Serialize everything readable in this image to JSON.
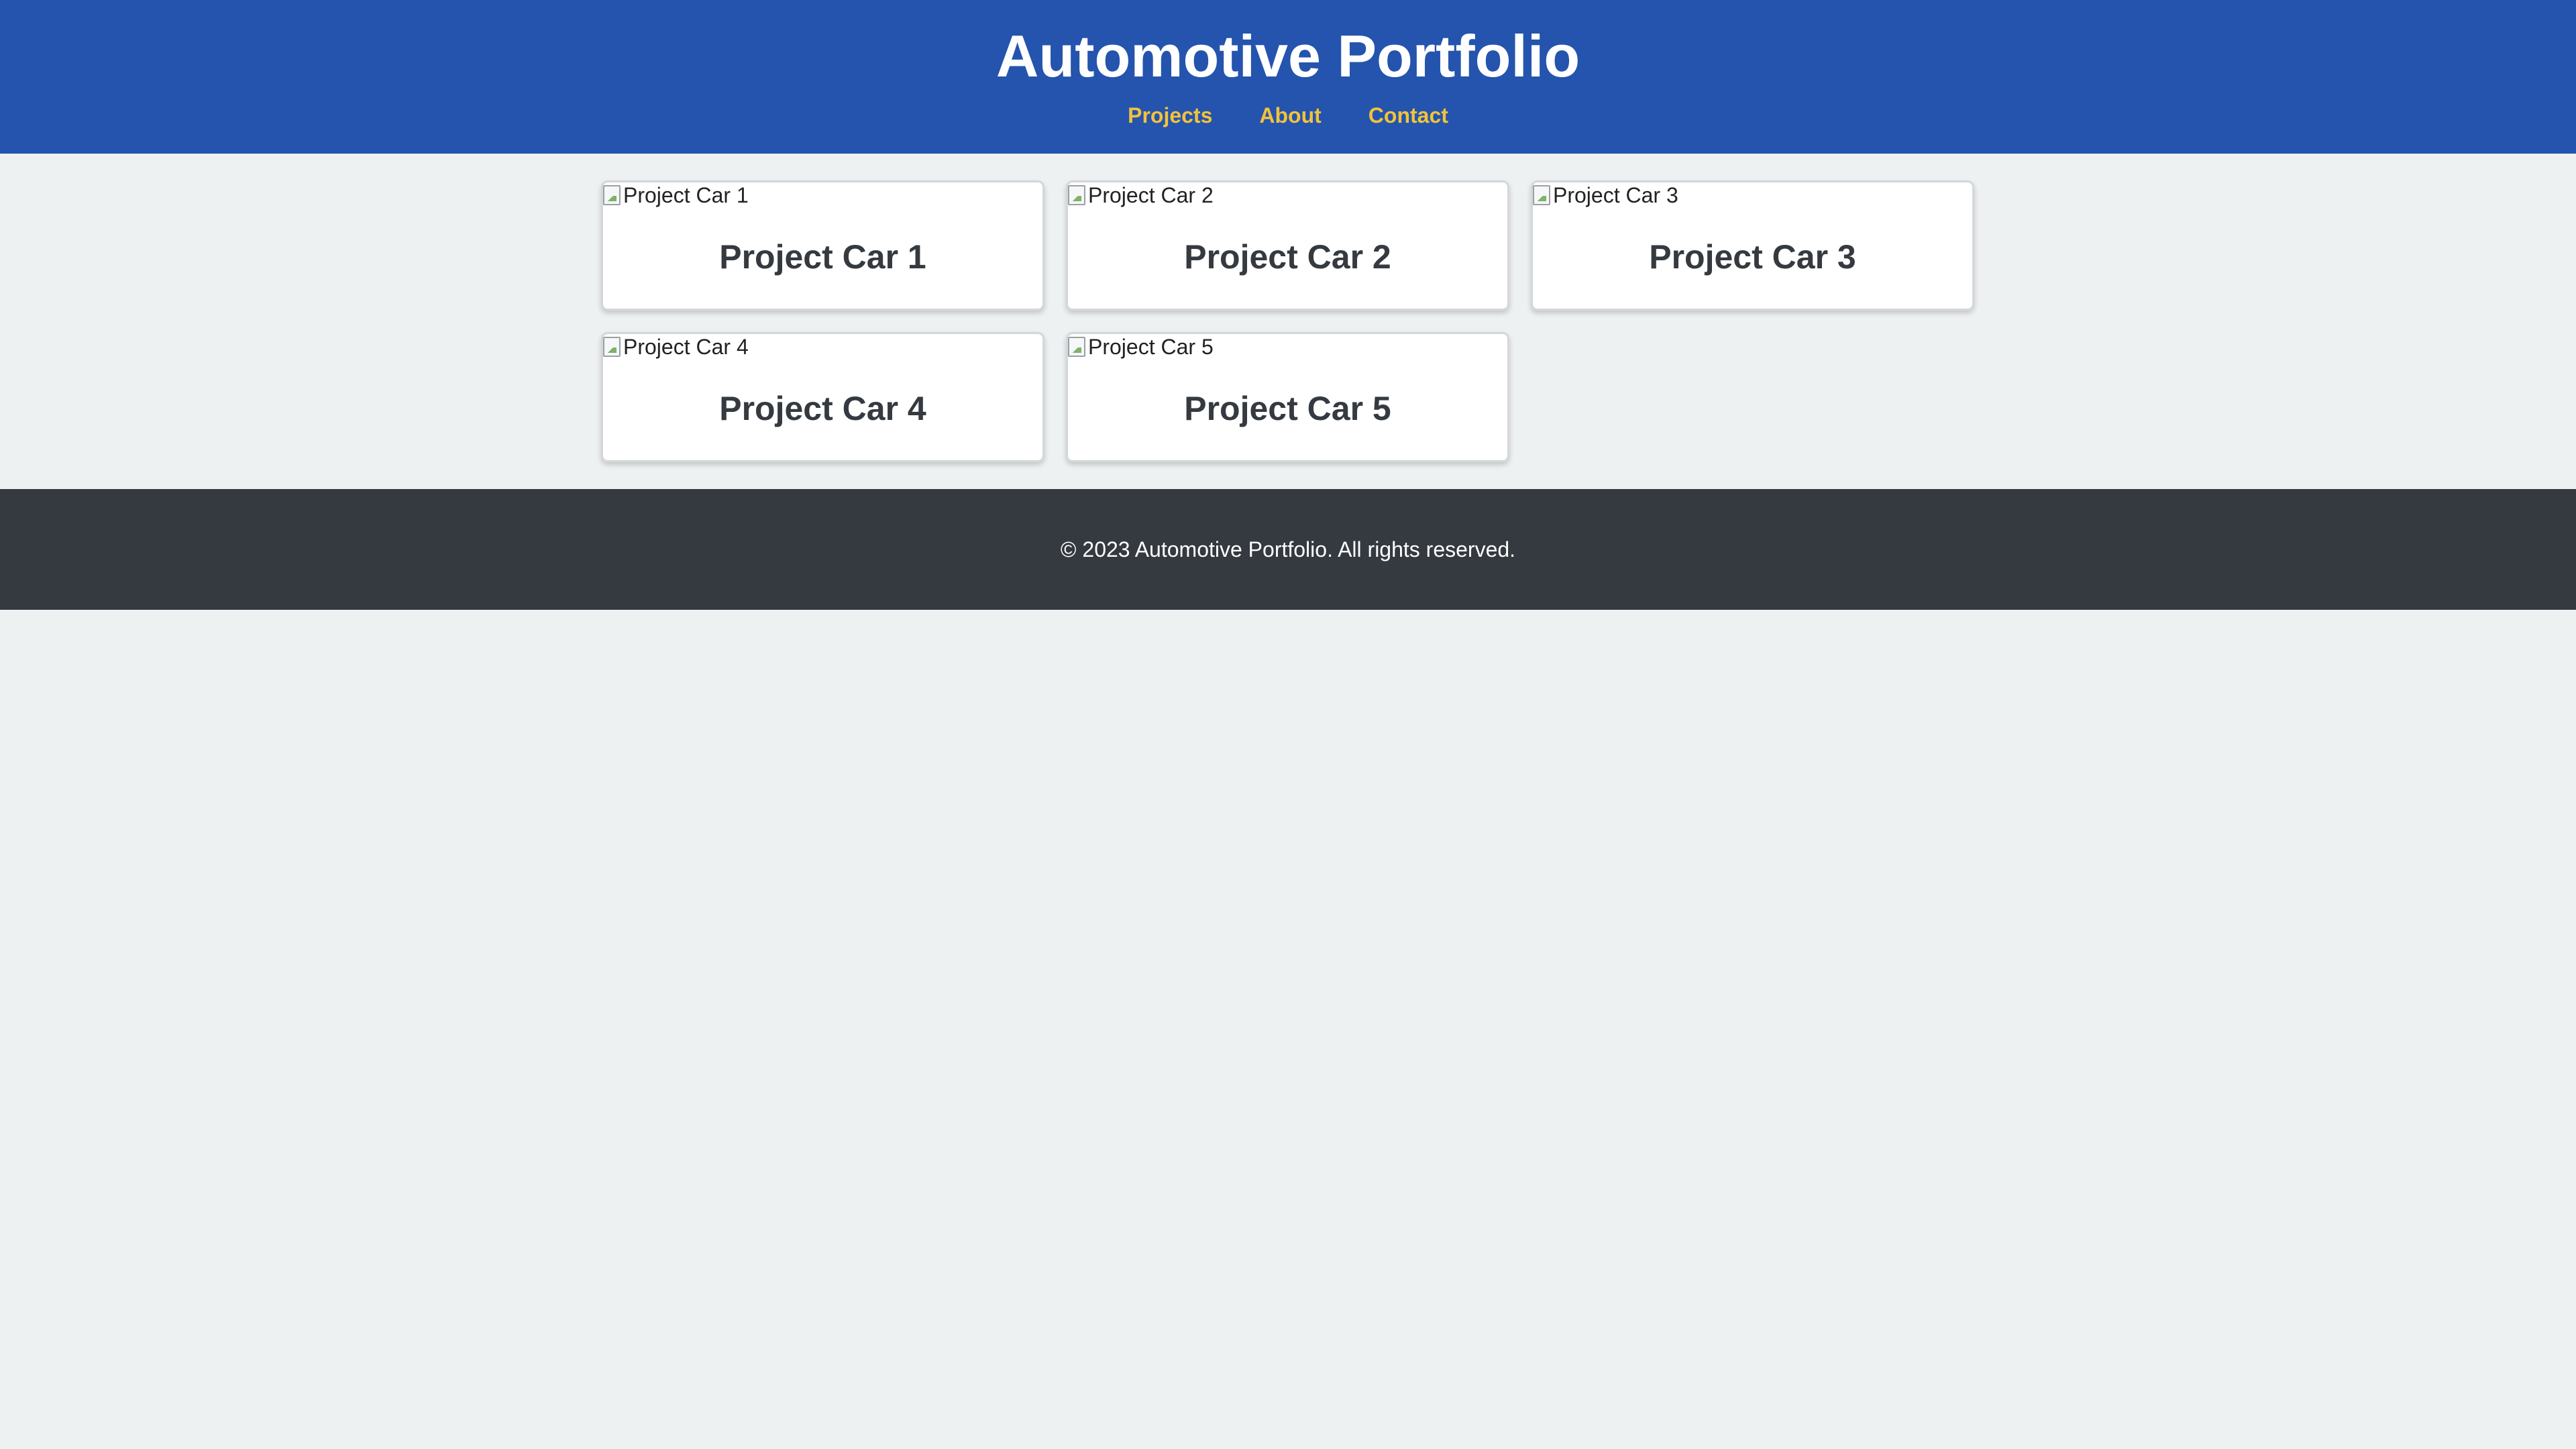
{
  "header": {
    "title": "Automotive Portfolio",
    "nav": [
      {
        "label": "Projects"
      },
      {
        "label": "About"
      },
      {
        "label": "Contact"
      }
    ]
  },
  "projects": [
    {
      "image_alt": "Project Car 1",
      "title": "Project Car 1"
    },
    {
      "image_alt": "Project Car 2",
      "title": "Project Car 2"
    },
    {
      "image_alt": "Project Car 3",
      "title": "Project Car 3"
    },
    {
      "image_alt": "Project Car 4",
      "title": "Project Car 4"
    },
    {
      "image_alt": "Project Car 5",
      "title": "Project Car 5"
    }
  ],
  "footer": {
    "text": "© 2023 Automotive Portfolio. All rights reserved."
  },
  "colors": {
    "header_bg": "#2454ad",
    "nav_link": "#f2c23c",
    "page_bg": "#eef1f2",
    "card_bg": "#ffffff",
    "card_title": "#343a40",
    "footer_bg": "#353940"
  },
  "icons": {
    "card_image": "broken-image-icon"
  }
}
